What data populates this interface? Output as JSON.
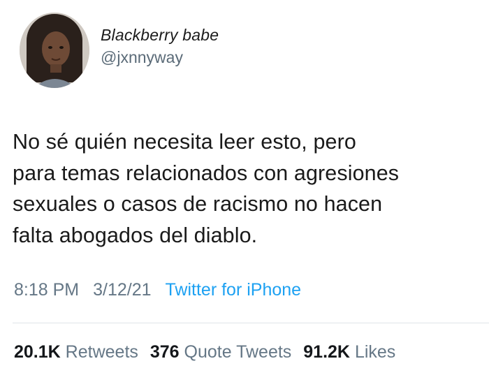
{
  "user": {
    "display_name": "Blackberry babe",
    "handle": "@jxnnyway"
  },
  "tweet": {
    "text": "No sé quién necesita leer esto, pero\npara temas relacionados con agresiones\nsexuales o casos de racismo no hacen\nfalta abogados del diablo.",
    "time": "8:18 PM",
    "date": "3/12/21",
    "source": "Twitter for iPhone"
  },
  "stats": {
    "retweets_count": "20.1K",
    "retweets_label": "Retweets",
    "quotes_count": "376",
    "quotes_label": "Quote Tweets",
    "likes_count": "91.2K",
    "likes_label": "Likes"
  },
  "colors": {
    "link": "#1da1f2",
    "secondary_text": "#657786",
    "primary_text": "#14171a"
  }
}
